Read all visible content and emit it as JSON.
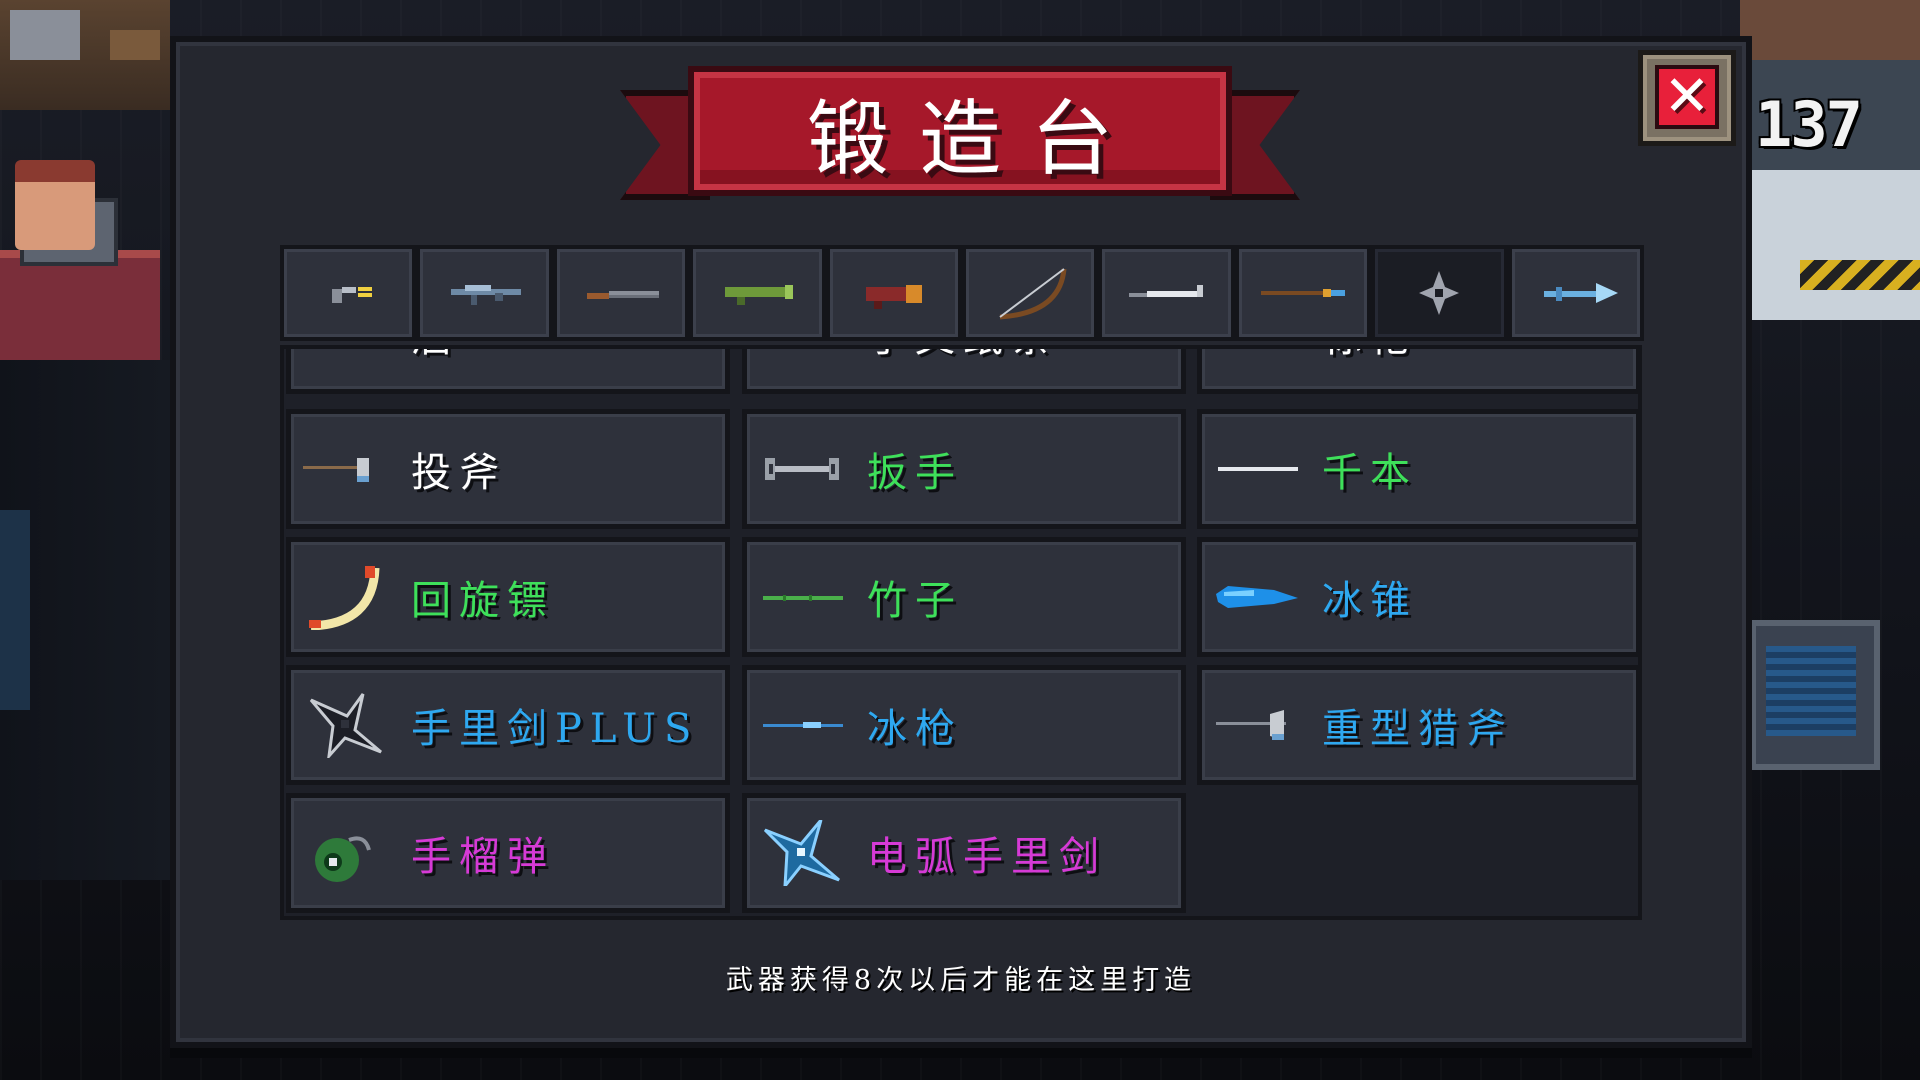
{
  "title": "锻造台",
  "coin_count": "137",
  "close_label": "✕",
  "tabs": [
    {
      "icon": "pistol-icon"
    },
    {
      "icon": "rifle-icon"
    },
    {
      "icon": "shotgun-icon"
    },
    {
      "icon": "launcher-icon"
    },
    {
      "icon": "cannon-icon"
    },
    {
      "icon": "bow-icon"
    },
    {
      "icon": "blade-icon"
    },
    {
      "icon": "spear-icon"
    },
    {
      "icon": "shuriken-icon",
      "active": true
    },
    {
      "icon": "staff-icon"
    }
  ],
  "items": [
    {
      "name": "酒",
      "color": "#ffffff",
      "icon": "bottle-icon"
    },
    {
      "name": "手叉纸条",
      "color": "#ffffff",
      "icon": "paper-icon"
    },
    {
      "name": "标枪",
      "color": "#ffffff",
      "icon": "javelin-icon"
    },
    {
      "name": "投斧",
      "color": "#ffffff",
      "icon": "throwing-axe-icon"
    },
    {
      "name": "扳手",
      "color": "#3ee05a",
      "icon": "wrench-icon"
    },
    {
      "name": "千本",
      "color": "#3ee05a",
      "icon": "senbon-icon"
    },
    {
      "name": "回旋镖",
      "color": "#3ee05a",
      "icon": "boomerang-icon"
    },
    {
      "name": "竹子",
      "color": "#3ee05a",
      "icon": "bamboo-icon"
    },
    {
      "name": "冰锥",
      "color": "#2ea8f0",
      "icon": "ice-cone-icon"
    },
    {
      "name": "手里剑PLUS",
      "color": "#2ea8f0",
      "icon": "shuriken-plus-icon"
    },
    {
      "name": "冰枪",
      "color": "#2ea8f0",
      "icon": "ice-spear-icon"
    },
    {
      "name": "重型猎斧",
      "color": "#2ea8f0",
      "icon": "heavy-axe-icon"
    },
    {
      "name": "手榴弹",
      "color": "#d63ad6",
      "icon": "grenade-icon"
    },
    {
      "name": "电弧手里剑",
      "color": "#d63ad6",
      "icon": "arc-shuriken-icon"
    }
  ],
  "footer_hint": "武器获得8次以后才能在这里打造"
}
